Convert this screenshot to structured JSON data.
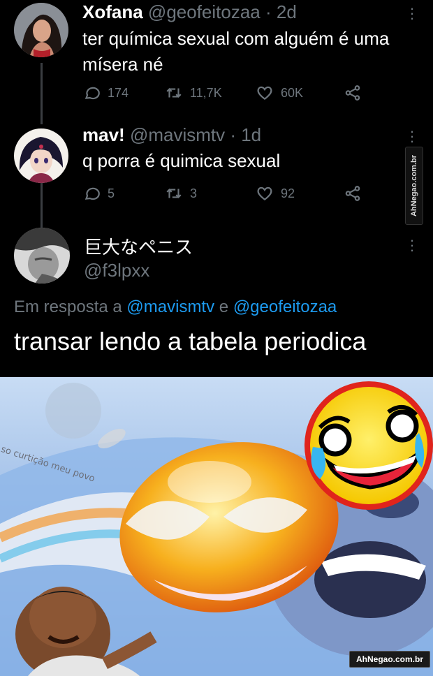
{
  "tweets": [
    {
      "name": "Xofana",
      "handle": "@geofeitozaa · 2d",
      "lines": [
        "ter química sexual com alguém é uma",
        "mísera né"
      ],
      "replies": "174",
      "retweets": "11,7K",
      "likes": "60K"
    },
    {
      "name": "mav!",
      "handle": "@mavismtv · 1d",
      "lines": [
        "q porra é quimica sexual"
      ],
      "replies": "5",
      "retweets": "3",
      "likes": "92"
    }
  ],
  "main_tweet": {
    "name": "巨大なペニス",
    "handle": "@f3lpxx",
    "reply_prefix": "Em resposta a",
    "mention_1": "@mavismtv",
    "reply_joiner": "e",
    "mention_2": "@geofeitozaa",
    "text": "transar lendo a tabela periodica"
  },
  "meme": {
    "caption": "so curtição meu povo"
  },
  "watermarks": {
    "side": "AhNegao.com.br",
    "bottom": "AhNegao.com.br"
  },
  "colors": {
    "background": "#000000",
    "secondary_text": "#6e767d",
    "link": "#1d9bf0"
  }
}
